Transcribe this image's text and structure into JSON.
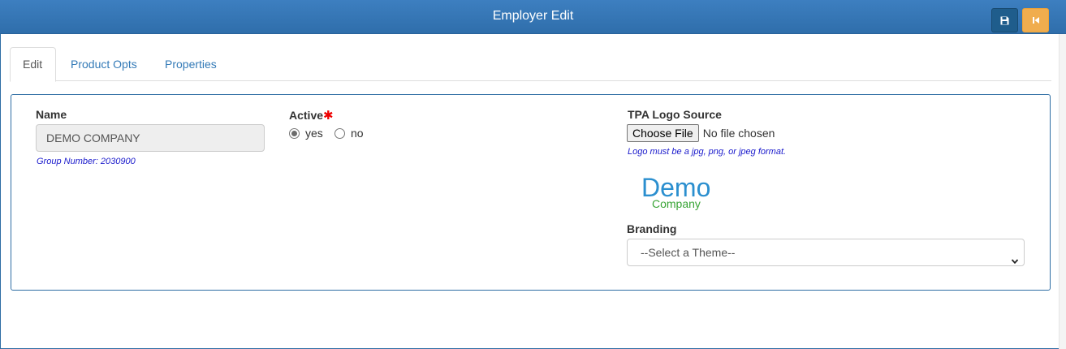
{
  "header": {
    "title": "Employer Edit",
    "save_icon": "floppy-disk-icon",
    "back_icon": "step-backward-icon",
    "colors": {
      "bar": "#3377b8",
      "save_button": "#1f5d8c",
      "back_button": "#f0ad4e"
    }
  },
  "tabs": [
    {
      "label": "Edit",
      "active": true
    },
    {
      "label": "Product Opts",
      "active": false
    },
    {
      "label": "Properties",
      "active": false
    }
  ],
  "form": {
    "name": {
      "label": "Name",
      "value": "DEMO COMPANY",
      "group_number": "Group Number: 2030900"
    },
    "active": {
      "label": "Active",
      "required_marker": "✱",
      "options": [
        {
          "label": "yes",
          "selected": true
        },
        {
          "label": "no",
          "selected": false
        }
      ]
    },
    "tpa_logo": {
      "label": "TPA Logo Source",
      "button_label": "Choose File",
      "status": "No file chosen",
      "hint": "Logo must be a jpg, png, or jpeg format.",
      "logo_word": "Demo",
      "logo_subword": "Company"
    },
    "branding": {
      "label": "Branding",
      "selected": "--Select a Theme--"
    }
  }
}
